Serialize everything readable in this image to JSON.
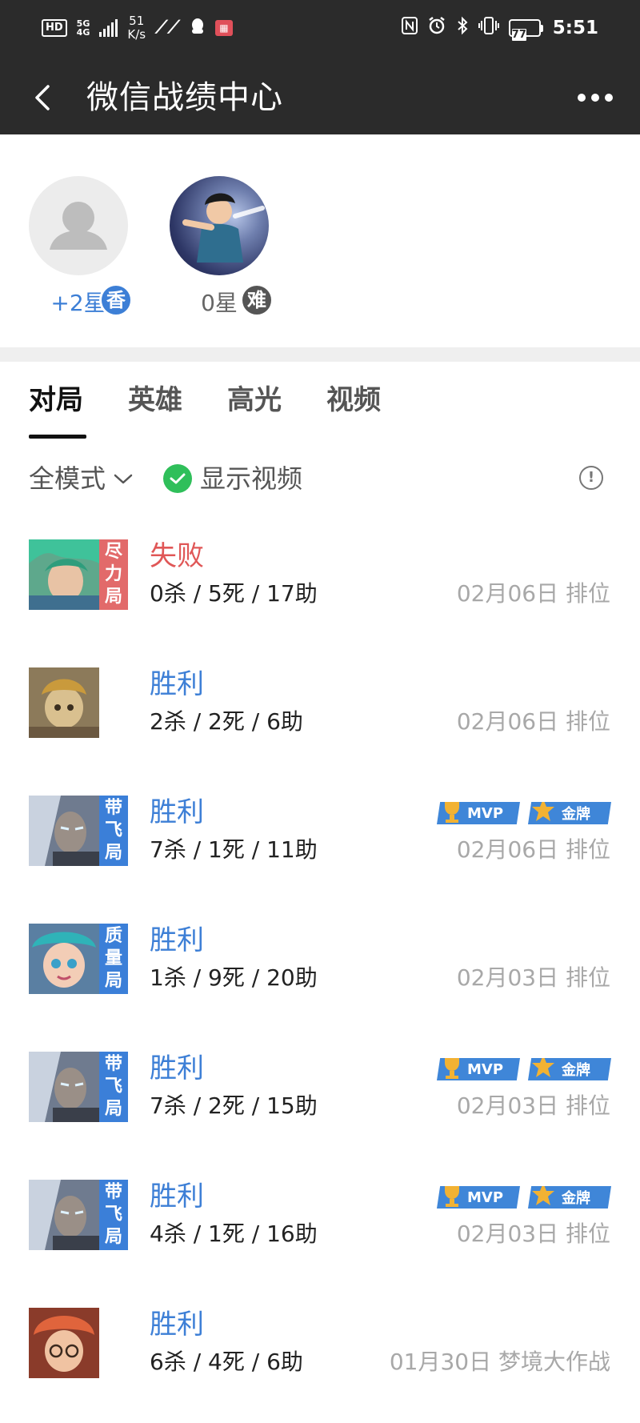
{
  "status_bar": {
    "hd": "HD",
    "network": "5G",
    "network_sub": "4G",
    "speed_value": "51",
    "speed_unit": "K/s",
    "battery": "77",
    "time": "5:51"
  },
  "header": {
    "title": "微信战绩中心"
  },
  "profiles": [
    {
      "badge": "香",
      "stars": "+2星",
      "star_color": "#3d7fd6"
    },
    {
      "badge": "难",
      "stars": "0星",
      "star_color": "#666666"
    }
  ],
  "tabs": [
    "对局",
    "英雄",
    "高光",
    "视频"
  ],
  "filter": {
    "mode": "全模式",
    "show_video": "显示视频"
  },
  "matches": [
    {
      "tag": [
        "尽",
        "力",
        "局"
      ],
      "tag_color": "red",
      "result": "失败",
      "result_type": "lose",
      "kda": "0杀 / 5死 / 17助",
      "meta": "02月06日  排位",
      "mvp": false
    },
    {
      "tag": [],
      "tag_color": "",
      "result": "胜利",
      "result_type": "win",
      "kda": "2杀 / 2死 / 6助",
      "meta": "02月06日  排位",
      "mvp": false
    },
    {
      "tag": [
        "带",
        "飞",
        "局"
      ],
      "tag_color": "blue",
      "result": "胜利",
      "result_type": "win",
      "kda": "7杀 / 1死 / 11助",
      "meta": "02月06日  排位",
      "mvp": true
    },
    {
      "tag": [
        "质",
        "量",
        "局"
      ],
      "tag_color": "blue",
      "result": "胜利",
      "result_type": "win",
      "kda": "1杀 / 9死 / 20助",
      "meta": "02月03日  排位",
      "mvp": false
    },
    {
      "tag": [
        "带",
        "飞",
        "局"
      ],
      "tag_color": "blue",
      "result": "胜利",
      "result_type": "win",
      "kda": "7杀 / 2死 / 15助",
      "meta": "02月03日  排位",
      "mvp": true
    },
    {
      "tag": [
        "带",
        "飞",
        "局"
      ],
      "tag_color": "blue",
      "result": "胜利",
      "result_type": "win",
      "kda": "4杀 / 1死 / 16助",
      "meta": "02月03日  排位",
      "mvp": true
    },
    {
      "tag": [],
      "tag_color": "",
      "result": "胜利",
      "result_type": "win",
      "kda": "6杀 / 4死 / 6助",
      "meta": "01月30日  梦境大作战",
      "mvp": false
    }
  ],
  "badges": {
    "mvp": "MVP",
    "gold": "金牌"
  },
  "colors": {
    "header_bg": "#2b2b2b",
    "win": "#3d7fd6",
    "lose": "#e05757",
    "tag_blue": "#3b7fd8",
    "tag_red": "#e26a6a",
    "check_green": "#2fbf5a"
  }
}
